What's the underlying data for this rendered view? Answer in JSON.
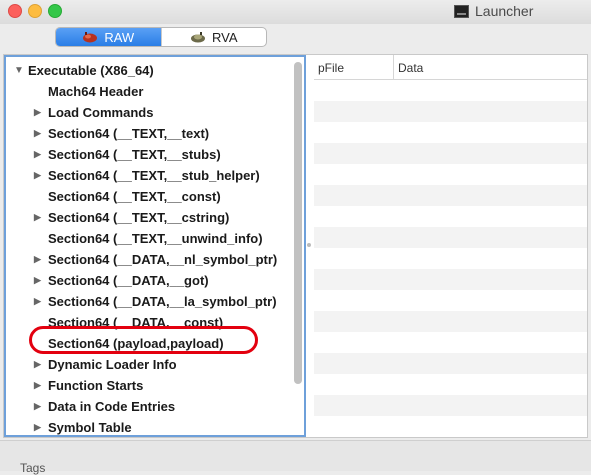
{
  "window": {
    "title": "Launcher",
    "icon": "terminal-icon"
  },
  "segmented": {
    "raw_label": "RAW",
    "rva_label": "RVA",
    "active": "RAW",
    "accent": "#2a7ee6"
  },
  "tree": {
    "items": [
      {
        "label": "Executable  (X86_64)",
        "disclosure": "expanded",
        "level": 0
      },
      {
        "label": "Mach64 Header",
        "disclosure": "none",
        "level": 1
      },
      {
        "label": "Load Commands",
        "disclosure": "collapsed",
        "level": 1
      },
      {
        "label": "Section64 (__TEXT,__text)",
        "disclosure": "collapsed",
        "level": 1
      },
      {
        "label": "Section64 (__TEXT,__stubs)",
        "disclosure": "collapsed",
        "level": 1
      },
      {
        "label": "Section64 (__TEXT,__stub_helper)",
        "disclosure": "collapsed",
        "level": 1
      },
      {
        "label": "Section64 (__TEXT,__const)",
        "disclosure": "none",
        "level": 1
      },
      {
        "label": "Section64 (__TEXT,__cstring)",
        "disclosure": "collapsed",
        "level": 1
      },
      {
        "label": "Section64 (__TEXT,__unwind_info)",
        "disclosure": "none",
        "level": 1
      },
      {
        "label": "Section64 (__DATA,__nl_symbol_ptr)",
        "disclosure": "collapsed",
        "level": 1
      },
      {
        "label": "Section64 (__DATA,__got)",
        "disclosure": "collapsed",
        "level": 1
      },
      {
        "label": "Section64 (__DATA,__la_symbol_ptr)",
        "disclosure": "collapsed",
        "level": 1
      },
      {
        "label": "Section64 (__DATA,__const)",
        "disclosure": "none",
        "level": 1
      },
      {
        "label": "Section64 (payload,payload)",
        "disclosure": "none",
        "level": 1,
        "annotated": true
      },
      {
        "label": "Dynamic Loader Info",
        "disclosure": "collapsed",
        "level": 1
      },
      {
        "label": "Function Starts",
        "disclosure": "collapsed",
        "level": 1
      },
      {
        "label": "Data in Code Entries",
        "disclosure": "collapsed",
        "level": 1
      },
      {
        "label": "Symbol Table",
        "disclosure": "collapsed",
        "level": 1
      }
    ]
  },
  "table": {
    "columns": [
      "pFile",
      "Data"
    ]
  },
  "annotation": {
    "color": "#e3000f"
  },
  "bottom": {
    "text": "Tags"
  }
}
